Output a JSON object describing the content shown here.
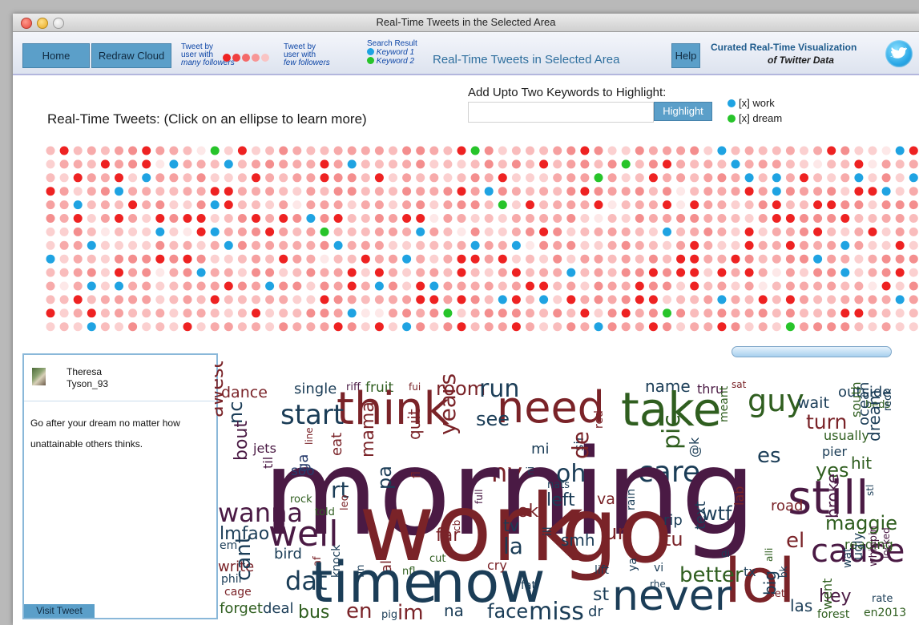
{
  "window": {
    "title": "Real-Time Tweets in the Selected Area"
  },
  "toolbar": {
    "home_label": "Home",
    "redraw_label": "Redraw Cloud",
    "many_followers_label": [
      "Tweet by",
      "user with",
      "many followers"
    ],
    "few_followers_label": [
      "Tweet by",
      "user with",
      "few followers"
    ],
    "search_result_label": "Search Result",
    "keyword1_label": "Keyword 1",
    "keyword2_label": "Keyword 2",
    "app_title": "Real-Time Tweets in Selected Area",
    "help_label": "Help",
    "brand_line1": "Curated Real-Time Visualization",
    "brand_line2": "of Twitter Data"
  },
  "main": {
    "section_label": "Real-Time Tweets: (Click on an ellipse to learn more)",
    "add_keywords_label": "Add Upto Two Keywords to Highlight:",
    "keyword_input_value": "",
    "highlight_label": "Highlight",
    "keyword_legend": [
      "[x] work",
      "[x] dream"
    ]
  },
  "colors": {
    "keyword1": "#1fa3e2",
    "keyword2": "#27c42a",
    "many_followers": "#ee2222",
    "few_followers": "#f7aaaa"
  },
  "tweet": {
    "user_name": "Theresa",
    "user_handle": "Tyson_93",
    "text": "Go after your dream no matter how unattainable others thinks.",
    "visit_label": "Visit Tweet"
  },
  "wordcloud": {
    "words": [
      "dance",
      "single",
      "riff",
      "fruit",
      "fui",
      "room",
      "run",
      "name",
      "thru",
      "sat",
      "outside",
      "think",
      "need",
      "take",
      "guy",
      "wait",
      "beds",
      "awesome",
      "start",
      "see",
      "care",
      "turn",
      "usually",
      "south",
      "reck",
      "nc",
      "years",
      "quit",
      "ny",
      "sir",
      "meant",
      "es",
      "pier",
      "hit",
      "ocean",
      "dream",
      "morning",
      "jets",
      "line",
      "mama",
      "mi",
      "oh",
      "ni",
      "de",
      "red",
      "pic",
      "@k",
      "yes",
      "til",
      "soo",
      "eat",
      "fl",
      "nats",
      "left",
      "va",
      "lab",
      "still",
      "bout",
      "ga",
      "rt",
      "leo",
      "pa",
      "ok",
      "road",
      "stl",
      "rock",
      "told",
      "wanna",
      "work",
      "go",
      "tv",
      "smh",
      "ur",
      "rain",
      "rip",
      "wtf",
      "cause",
      "maggie",
      "lmfao",
      "well",
      "far",
      "la",
      "tu",
      "text",
      "el",
      "broke",
      "reading",
      "em",
      "cb",
      "full",
      "ill",
      "di",
      "wat",
      "ugly",
      "whippin",
      "write",
      "bird",
      "nfl",
      "cut",
      "lol",
      "alli",
      "locked",
      "cant",
      "af",
      "fin",
      "al",
      "time",
      "now",
      "lift",
      "vi",
      "better",
      "tx",
      "big",
      "rate",
      "phil",
      "dat",
      "knock",
      "cry",
      "fat",
      "ya",
      "rhe",
      "set",
      "bk",
      "hey",
      "went",
      "cage",
      "st",
      "never",
      "las",
      "forest",
      "forget",
      "deal",
      "bus",
      "en",
      "pig",
      "im",
      "na",
      "face",
      "miss",
      "dr",
      "en2013"
    ]
  }
}
